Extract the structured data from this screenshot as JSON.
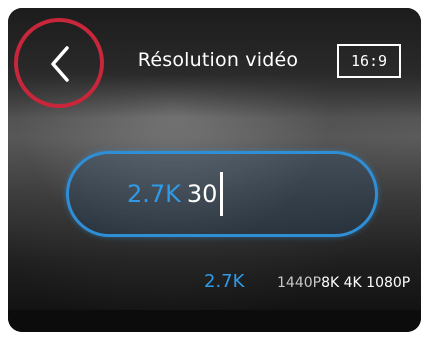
{
  "header": {
    "title": "Résolution vidéo",
    "aspect_ratio": "16:9"
  },
  "selector": {
    "resolution": "2.7K",
    "fps": "30"
  },
  "options": {
    "selected": "2.7K",
    "items": [
      "1440P",
      "8K",
      "4K",
      "1080P"
    ]
  },
  "colors": {
    "accent": "#2f9be8",
    "highlight_ring": "#c8263a"
  },
  "icons": {
    "back": "chevron-left-icon"
  }
}
